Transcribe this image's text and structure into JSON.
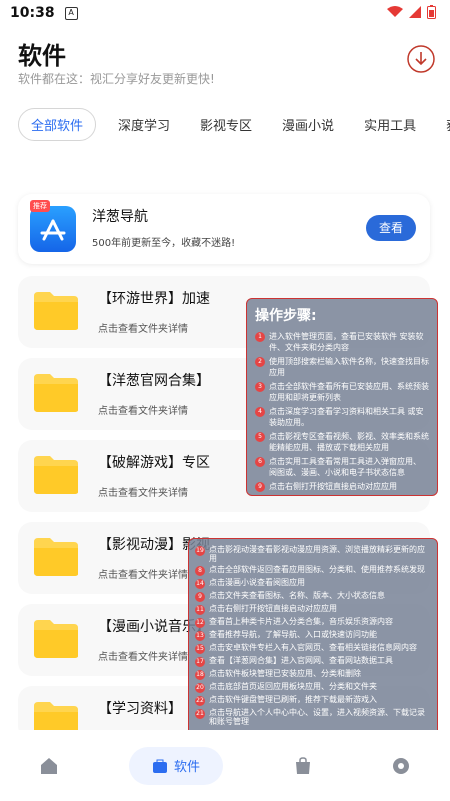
{
  "status": {
    "time": "10:38"
  },
  "header": {
    "title": "软件",
    "subtitle": "软件都在这：视汇分享好友更新更快!"
  },
  "tabs": [
    "全部软件",
    "深度学习",
    "影视专区",
    "漫画小说",
    "实用工具",
    "获"
  ],
  "nav_card": {
    "badge": "推荐",
    "title": "洋葱导航",
    "subtitle": "500年前更新至今，收藏不迷路!",
    "button": "查看"
  },
  "folders": [
    {
      "name": "【环游世界】加速",
      "desc": "点击查看文件夹详情"
    },
    {
      "name": "【洋葱官网合集】",
      "desc": "点击查看文件夹详情"
    },
    {
      "name": "【破解游戏】专区",
      "desc": "点击查看文件夹详情"
    },
    {
      "name": "【影视动漫】影视",
      "desc": "点击查看文件夹详情"
    },
    {
      "name": "【漫画小说音乐】",
      "desc": "点击查看文件夹详情"
    },
    {
      "name": "【学习资料】",
      "desc": "点击查看文件夹详情"
    }
  ],
  "steps": {
    "title": "操作步骤:",
    "items": [
      "进入软件管理页面，查看已安装软件 安装软件、文件夹和分类内容",
      "使用顶部搜索栏输入软件名称，快速查找目标应用",
      "点击全部软件查看所有已安装应用、系统预装应用和即将更新列表",
      "点击深度学习查看学习资料和相关工具 或安装助应用。",
      "点击影视专区查看视频、影视、效率类和系统能精能应用、播放或下载相关应用",
      "点击实用工具查看常用工具进入弹窗应用、 阅图或、漫画、小说和电子书状态信息",
      "点击右侧打开按钮直接启动对应应用"
    ]
  },
  "steps2": {
    "items": [
      "点击影视动漫查看影视动漫应用资源、浏览播放精彩更新的应用",
      "点击全部软件返回查看应用图标、分类和、使用推荐系统发现",
      "点击漫画小说查看阅图应用",
      "点击文件夹查看图标、名称、版本、大小状态信息",
      "点击右侧打开按钮直接启动对应应用",
      "查看首上种类卡片进入分类合集，音乐娱乐资源内容",
      "查看推荐导航，了解导航、入口或快速访问功能",
      "点击安卓软件专栏入有入官网页、查看相关链接信息网内容",
      "查看【洋葱网合集】进入官网网、查看网站数据工具",
      "点击软件板块管理已安装应用、分类和删除",
      "点击底部首页返回应用板块应用、分类和文件夹",
      "点击软件键盘管理已刷新，推荐下载最新游戏入",
      "点击导航进入个人中心中心、设置，进入视频资源、下载记录和账号管理"
    ],
    "start": 19
  },
  "bottom_nav": {
    "active_label": "软件"
  }
}
